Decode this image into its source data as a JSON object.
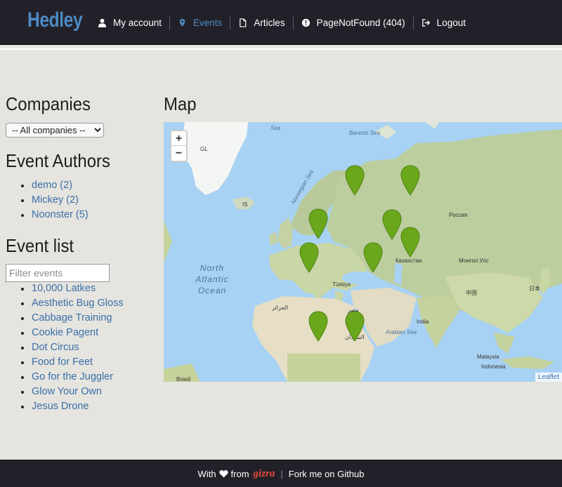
{
  "navbar": {
    "brand": "Hedley",
    "links": [
      {
        "label": "My account",
        "icon": "user-icon"
      },
      {
        "label": "Events",
        "icon": "map-marker-icon",
        "active": true
      },
      {
        "label": "Articles",
        "icon": "file-icon"
      },
      {
        "label": "PageNotFound (404)",
        "icon": "exclamation-circle-icon"
      },
      {
        "label": "Logout",
        "icon": "logout-icon"
      }
    ],
    "colors": {
      "background": "#222129",
      "accent": "#4e8bc4"
    }
  },
  "companies": {
    "heading": "Companies",
    "selected": "-- All companies --"
  },
  "authors": {
    "heading": "Event Authors",
    "items": [
      "demo (2)",
      "Mickey (2)",
      "Noonster (5)"
    ]
  },
  "event_list": {
    "heading": "Event list",
    "filter_placeholder": "Filter events",
    "items": [
      "10,000 Latkes",
      "Aesthetic Bug Gloss",
      "Cabbage Training",
      "Cookie Pagent",
      "Dot Circus",
      "Food for Feet",
      "Go for the Juggler",
      "Glow Your Own",
      "Jesus Drone"
    ]
  },
  "map": {
    "heading": "Map",
    "zoom_in": "+",
    "zoom_out": "−",
    "attribution": "Leaflet",
    "marker_color": "#6aa71b",
    "labels": {
      "ocean": "North Atlantic Ocean",
      "barents": "Barents Sea",
      "sea": "Sea",
      "norwegian": "Norwegian Sea",
      "arabian": "Arabian Sea",
      "gl": "GL",
      "is": "IS",
      "russia": "Россия",
      "kazakhstan": "Казахстан",
      "mongolia": "Монгол Улс",
      "turkey": "Türkiye",
      "sudan": "السودان",
      "egypt": "مصر",
      "algeria": "الجزائر",
      "india": "India",
      "malaysia": "Malaysia",
      "indonesia": "Indonesia",
      "brasil": "Brasil",
      "japan": "日本",
      "china": "中国"
    }
  },
  "footer": {
    "with": "With",
    "from": "from",
    "logo": "gizra",
    "fork": "Fork me on Github"
  }
}
